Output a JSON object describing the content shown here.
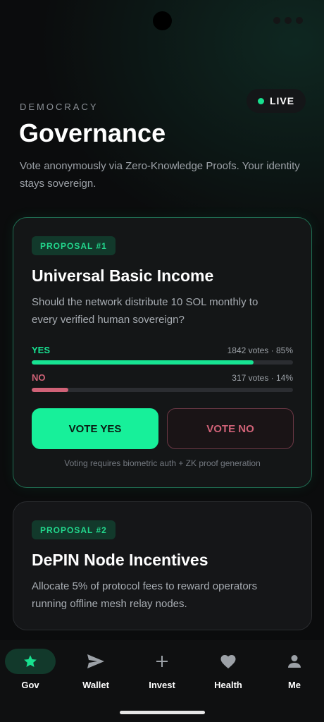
{
  "header": {
    "eyebrow": "DEMOCRACY",
    "title": "Governance",
    "subtitle": "Vote anonymously via Zero-Knowledge Proofs. Your identity stays sovereign.",
    "live_label": "LIVE"
  },
  "proposals": [
    {
      "tag": "PROPOSAL #1",
      "title": "Universal Basic Income",
      "description": "Should the network distribute 10 SOL monthly to every verified human sovereign?",
      "yes_label": "YES",
      "yes_meta": "1842 votes · 85%",
      "yes_fraction": 0.85,
      "no_label": "NO",
      "no_meta": "317 votes · 14%",
      "no_fraction": 0.14,
      "vote_yes_label": "VOTE YES",
      "vote_no_label": "VOTE NO",
      "note": "Voting requires biometric auth + ZK proof generation"
    },
    {
      "tag": "PROPOSAL #2",
      "title": "DePIN Node Incentives",
      "description": "Allocate 5% of protocol fees to reward operators running offline mesh relay nodes."
    }
  ],
  "nav": {
    "items": [
      {
        "label": "Gov",
        "icon": "star-icon"
      },
      {
        "label": "Wallet",
        "icon": "send-icon"
      },
      {
        "label": "Invest",
        "icon": "plus-icon"
      },
      {
        "label": "Health",
        "icon": "heart-icon"
      },
      {
        "label": "Me",
        "icon": "person-icon"
      }
    ],
    "active_index": 0
  },
  "colors": {
    "accent": "#17f09a",
    "danger": "#d06277",
    "background": "#0b0c0d",
    "card": "#151618"
  }
}
